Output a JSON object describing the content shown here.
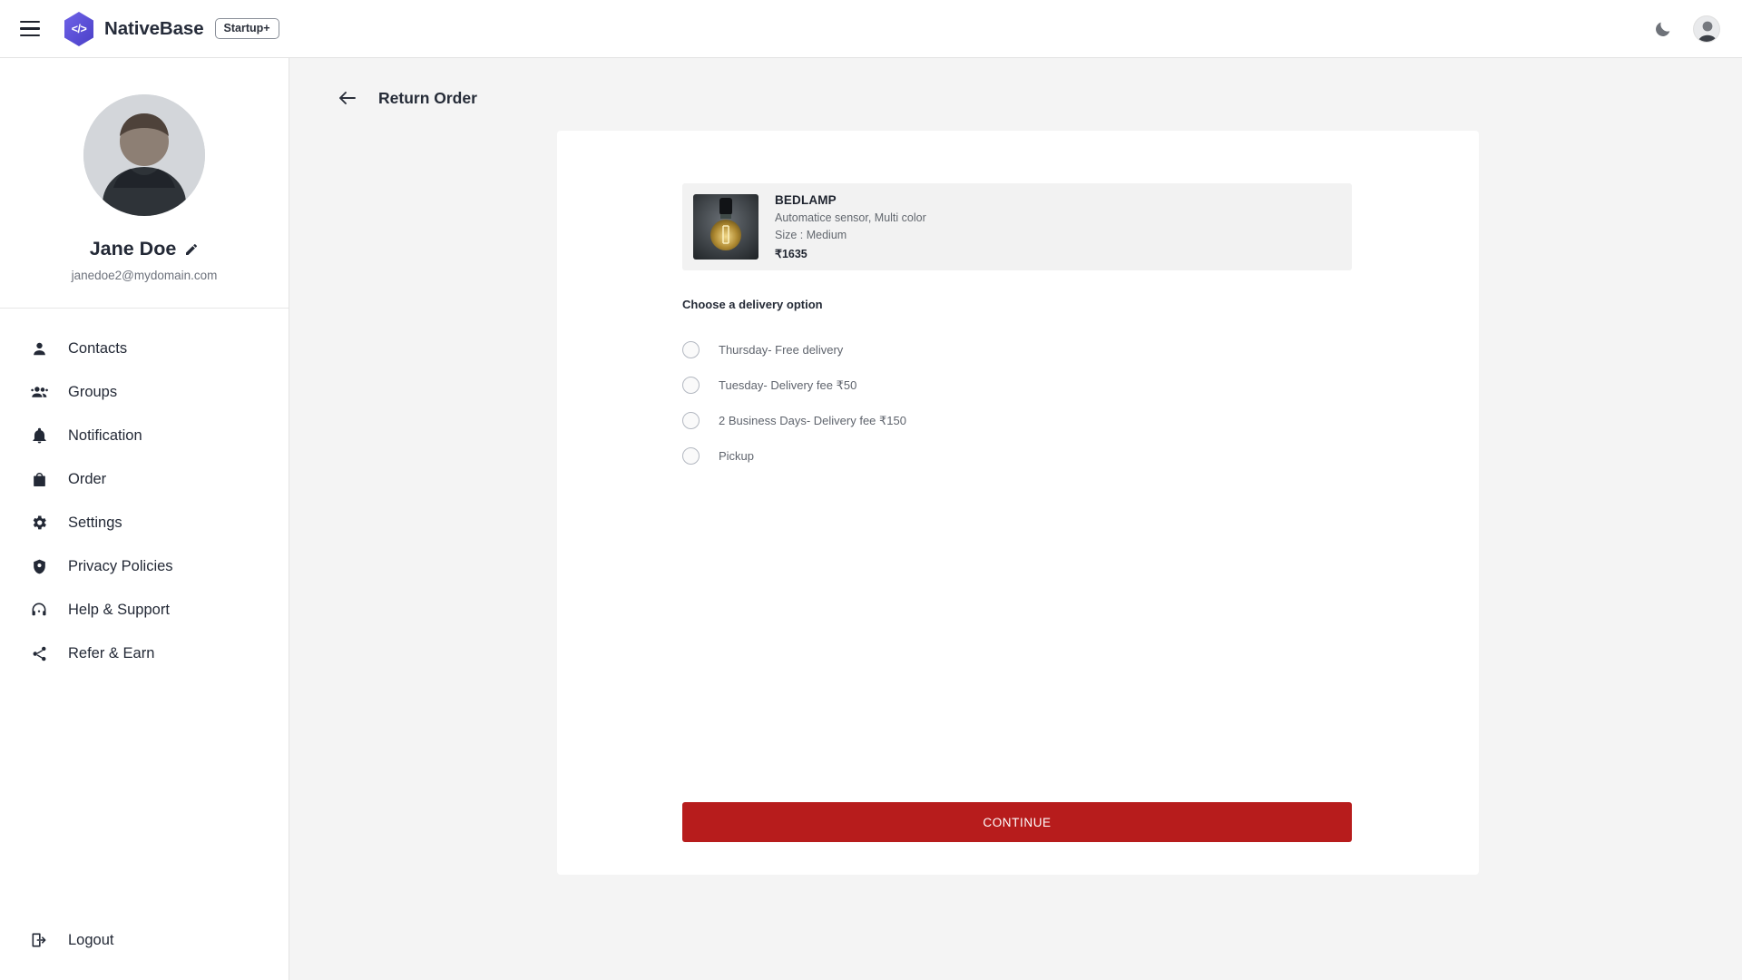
{
  "header": {
    "menu_icon": "hamburger-menu-icon",
    "logo_glyph": "</>",
    "brand_name": "NativeBase",
    "badge_label": "Startup+",
    "theme_toggle_icon": "moon-icon",
    "avatar_icon": "user-avatar"
  },
  "sidebar": {
    "profile": {
      "name": "Jane Doe",
      "edit_icon": "pencil-icon",
      "email": "janedoe2@mydomain.com"
    },
    "items": [
      {
        "label": "Contacts",
        "icon": "person-icon"
      },
      {
        "label": "Groups",
        "icon": "people-group-icon"
      },
      {
        "label": "Notification",
        "icon": "bell-icon"
      },
      {
        "label": "Order",
        "icon": "shopping-bag-icon"
      },
      {
        "label": "Settings",
        "icon": "gear-icon"
      },
      {
        "label": "Privacy Policies",
        "icon": "shield-icon"
      },
      {
        "label": "Help & Support",
        "icon": "headset-icon"
      },
      {
        "label": "Refer & Earn",
        "icon": "share-nodes-icon"
      }
    ],
    "logout": {
      "label": "Logout",
      "icon": "logout-icon"
    }
  },
  "main": {
    "back_icon": "arrow-left-icon",
    "title": "Return Order",
    "product": {
      "name": "BEDLAMP",
      "description": "Automatice sensor, Multi color",
      "size": "Size : Medium",
      "price": "₹1635",
      "image": "edison-bulb-photo"
    },
    "delivery": {
      "section_label": "Choose a delivery option",
      "options": [
        {
          "label": "Thursday- Free delivery",
          "selected": false
        },
        {
          "label": "Tuesday- Delivery fee ₹50",
          "selected": false
        },
        {
          "label": "2 Business Days- Delivery fee ₹150",
          "selected": false
        },
        {
          "label": "Pickup",
          "selected": false
        }
      ]
    },
    "continue_label": "CONTINUE"
  },
  "colors": {
    "accent_red": "#B71C1C",
    "brand_purple": "#5A52D5",
    "text_dark": "#232936",
    "page_bg": "#F4F4F4"
  }
}
